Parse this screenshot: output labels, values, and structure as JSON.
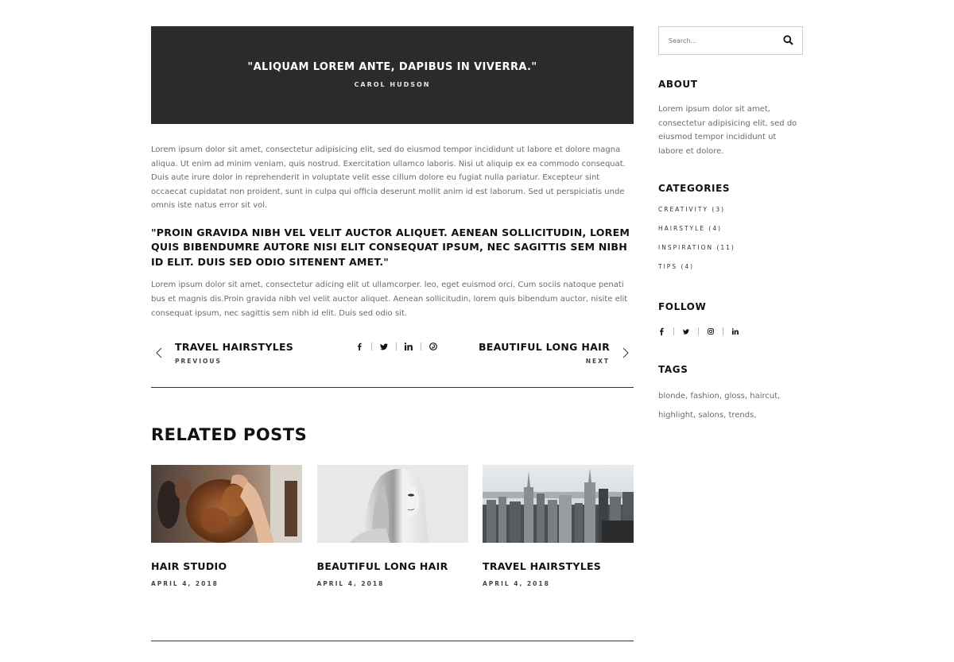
{
  "quote_block": {
    "text": "\"ALIQUAM LOREM ANTE, DAPIBUS IN VIVERRA.\"",
    "author": "CAROL HUDSON",
    "background": "#2b2b2b"
  },
  "article": {
    "paragraph1": "Lorem ipsum dolor sit amet, consectetur adipisicing elit, sed do eiusmod tempor incididunt ut labore et dolore magna aliqua. Ut enim ad minim veniam, quis nostrud. Exercitation ullamco laboris. Nisi ut aliquip ex ea commodo consequat. Duis aute irure dolor in reprehenderit in voluptate velit esse cillum dolore eu fugiat nulla pariatur. Excepteur sint occaecat cupidatat non proident, sunt in culpa qui officia deserunt mollit anim id est laborum. Sed ut perspiciatis unde omnis iste natus error sit vol.",
    "big_quote": "\"PROIN GRAVIDA NIBH VEL VELIT AUCTOR ALIQUET. AENEAN SOLLICITUDIN, LOREM QUIS BIBENDUMRE AUTORE NISI ELIT CONSEQUAT IPSUM, NEC SAGITTIS SEM NIBH ID ELIT. DUIS SED ODIO SITENENT AMET.\"",
    "paragraph2": "Lorem ipsum dolor sit amet, consectetur adicing elit ut ullamcorper. leo, eget euismod orci. Cum sociis natoque penati bus et magnis dis.Proin gravida nibh vel velit auctor aliquet. Aenean sollicitudin, lorem quis bibendum auctor, nisite elit consequat ipsum, nec sagittis sem nibh id elit. Duis sed odio sit."
  },
  "post_nav": {
    "prev_title": "TRAVEL HAIRSTYLES",
    "prev_label": "PREVIOUS",
    "next_title": "BEAUTIFUL LONG HAIR",
    "next_label": "NEXT",
    "share_icons": [
      "facebook-icon",
      "twitter-icon",
      "linkedin-icon",
      "pinterest-icon"
    ]
  },
  "related": {
    "title": "RELATED POSTS",
    "posts": [
      {
        "title": "HAIR STUDIO",
        "date": "APRIL 4, 2018",
        "image": "salon-hair-curling"
      },
      {
        "title": "BEAUTIFUL LONG HAIR",
        "date": "APRIL 4, 2018",
        "image": "woman-long-straight-hair-bw"
      },
      {
        "title": "TRAVEL HAIRSTYLES",
        "date": "APRIL 4, 2018",
        "image": "city-skyline"
      }
    ]
  },
  "sidebar": {
    "search_placeholder": "Search...",
    "about_title": "ABOUT",
    "about_text": "Lorem ipsum dolor sit amet, consectetur adipisicing elit, sed do eiusmod tempor incididunt ut labore et dolore.",
    "categories_title": "CATEGORIES",
    "categories": [
      {
        "label": "CREATIVITY (3)"
      },
      {
        "label": "HAIRSTYLE (4)"
      },
      {
        "label": "INSPIRATION (11)"
      },
      {
        "label": "TIPS (4)"
      }
    ],
    "follow_title": "FOLLOW",
    "follow_icons": [
      "facebook-icon",
      "twitter-icon",
      "instagram-icon",
      "linkedin-icon"
    ],
    "tags_title": "TAGS",
    "tags": "blonde, fashion, gloss, haircut, highlight, salons, trends,"
  }
}
